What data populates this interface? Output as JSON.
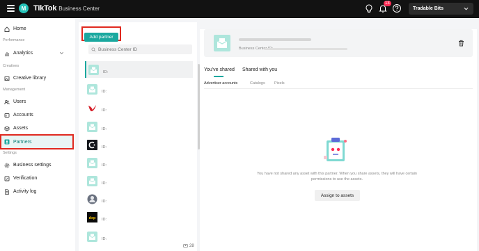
{
  "topbar": {
    "org_initial": "M",
    "logo": "TikTok",
    "product": "Business Center",
    "notification_count": "13",
    "account_name": "Tradable Bits",
    "icons": [
      "menu-icon",
      "lightbulb-icon",
      "bell-icon",
      "help-icon",
      "chevron-down-icon"
    ]
  },
  "sidebar": {
    "home": "Home",
    "performance_section": "Performance",
    "analytics": "Analytics",
    "creatives_section": "Creatives",
    "creative_library": "Creative library",
    "management_section": "Management",
    "users": "Users",
    "accounts": "Accounts",
    "assets": "Assets",
    "partners": "Partners",
    "settings_section": "Settings",
    "business_settings": "Business settings",
    "verification": "Verification",
    "activity_log": "Activity log"
  },
  "partners_list": {
    "add_partner_label": "Add partner",
    "search_placeholder": "Business Center ID",
    "rows": [
      {
        "id_label": "ID:",
        "avatar": "tiktok-default"
      },
      {
        "id_label": "ID:",
        "avatar": "tiktok-default"
      },
      {
        "id_label": "ID:",
        "avatar": "red-bird"
      },
      {
        "id_label": "ID:",
        "avatar": "tiktok-default"
      },
      {
        "id_label": "ID:",
        "avatar": "dark-c"
      },
      {
        "id_label": "ID:",
        "avatar": "tiktok-default"
      },
      {
        "id_label": "ID:",
        "avatar": "tiktok-default"
      },
      {
        "id_label": "ID:",
        "avatar": "photo-round"
      },
      {
        "id_label": "ID:",
        "avatar": "dxp"
      },
      {
        "id_label": "ID:",
        "avatar": "tiktok-default"
      }
    ],
    "total_count": "28"
  },
  "detail": {
    "bc_id_label": "Business Center ID:",
    "tabs": [
      "You've shared",
      "Shared with you"
    ],
    "subtabs": [
      "Advertiser accounts",
      "Catalogs",
      "Pixels"
    ],
    "empty_message": "You have not shared any asset with this partner. When you share assets, they will have certain permissions to use the assets.",
    "assign_button": "Assign to assets"
  },
  "colors": {
    "accent": "#1aa89f",
    "highlight_box": "#e0291f",
    "topbar": "#121212",
    "badge": "#fe2c55"
  }
}
